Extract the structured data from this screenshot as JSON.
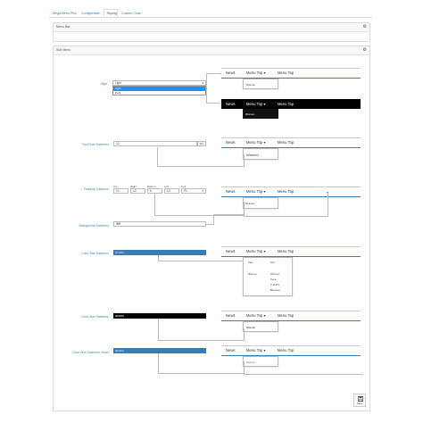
{
  "tabs": [
    {
      "label": "Mega Menu Plus",
      "active": false
    },
    {
      "label": "Configuration",
      "active": false
    },
    {
      "label": "Styling",
      "active": true
    },
    {
      "label": "Custom Code",
      "active": false
    }
  ],
  "menu_bar_panel": {
    "title": "Menu Bar"
  },
  "sub_menu_panel": {
    "title": "Sub Menu"
  },
  "style": {
    "label": "Style",
    "value": "Light",
    "options": [
      "Light",
      "Dark"
    ]
  },
  "font_size": {
    "label": "Font Size Submenu",
    "value": "13",
    "unit": "Px"
  },
  "padding": {
    "label": "Padding Submenu",
    "top_label": "Top",
    "top": "10",
    "right_label": "Right",
    "right": "10",
    "bottom_label": "Bottom",
    "bottom": "5",
    "left_label": "Left",
    "left": "10",
    "unit_label": "Unit",
    "unit": "Px"
  },
  "background": {
    "label": "Background Submenu",
    "value": "ffffff"
  },
  "color_title": {
    "label": "Color Title Submenu",
    "value": "3c7cb4",
    "color": "#3c7cb4"
  },
  "color_item": {
    "label": "Color Item Submenu",
    "value": "000000",
    "color": "#000000"
  },
  "color_item_hover": {
    "label": "Color Item Submenu Hover",
    "value": "3c7cb4",
    "color": "#3c7cb4"
  },
  "preview": {
    "news": "News",
    "menu_top": "Menu Top ▾",
    "menu_top_plain": "Menu Top",
    "women": "Women",
    "women_padded": "Women",
    "col_men": "Men",
    "col_girl": "Girl",
    "women_head": "Women",
    "women_sub": "Women",
    "tops": "Tops",
    "tshirts": "T-shirts",
    "blouses": "Blouses"
  },
  "save": {
    "label": "Save"
  }
}
